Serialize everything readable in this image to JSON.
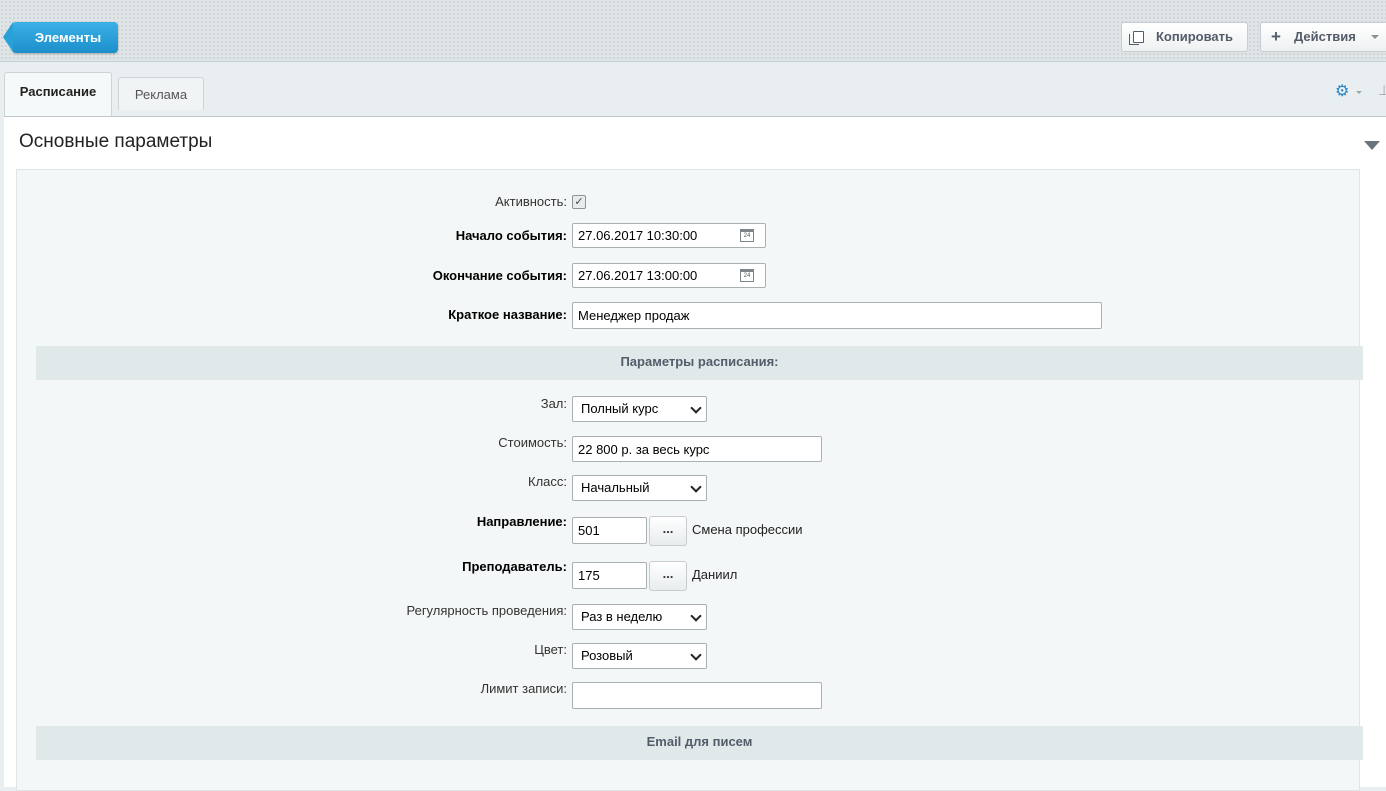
{
  "toolbar": {
    "back_label": "Элементы",
    "copy_label": "Копировать",
    "actions_label": "Действия"
  },
  "tabs": [
    {
      "label": "Расписание",
      "active": true
    },
    {
      "label": "Реклама",
      "active": false
    }
  ],
  "section": {
    "title": "Основные параметры"
  },
  "form": {
    "active": {
      "label": "Активность:",
      "checked": true
    },
    "start": {
      "label": "Начало события:",
      "value": "27.06.2017 10:30:00"
    },
    "end": {
      "label": "Окончание события:",
      "value": "27.06.2017 13:00:00"
    },
    "short_name": {
      "label": "Краткое название:",
      "value": "Менеджер продаж"
    },
    "schedule_header": "Параметры расписания:",
    "hall": {
      "label": "Зал:",
      "selected": "Полный курс"
    },
    "price": {
      "label": "Стоимость:",
      "value": "22 800 р. за весь курс"
    },
    "class": {
      "label": "Класс:",
      "selected": "Начальный"
    },
    "direction": {
      "label": "Направление:",
      "value": "501",
      "button": "...",
      "name": "Смена профессии"
    },
    "teacher": {
      "label": "Преподаватель:",
      "value": "175",
      "button": "...",
      "name": "Даниил"
    },
    "regularity": {
      "label": "Регулярность проведения:",
      "selected": "Раз в неделю"
    },
    "color": {
      "label": "Цвет:",
      "selected": "Розовый"
    },
    "limit": {
      "label": "Лимит записи:",
      "value": ""
    },
    "email_header": "Email для писем"
  },
  "icons": {
    "calendar_day": "24"
  }
}
